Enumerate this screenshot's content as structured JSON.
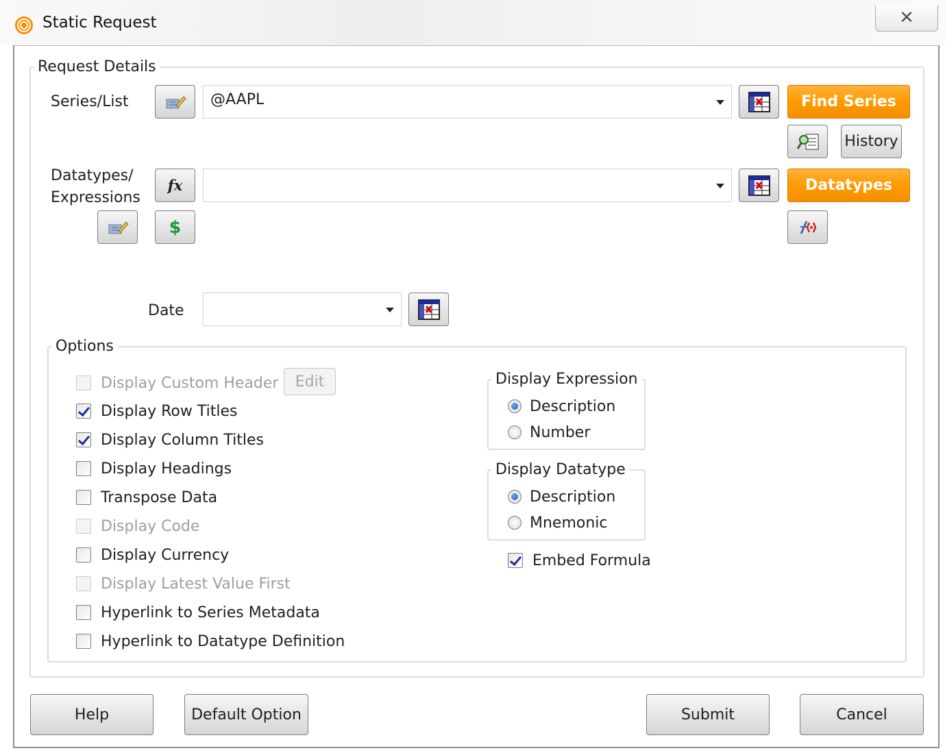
{
  "window": {
    "title": "Static Request",
    "close_glyph": "✕"
  },
  "request_details": {
    "legend": "Request Details",
    "series_label": "Series/List",
    "series_value": "@AAPL",
    "find_series_label": "Find Series",
    "history_label": "History",
    "datatypes_label_line1": "Datatypes/",
    "datatypes_label_line2": "Expressions",
    "datatypes_value": "",
    "datatypes_button_label": "Datatypes",
    "currency_glyph": "$",
    "fx_glyph": "fx",
    "date_label": "Date",
    "date_value": ""
  },
  "options": {
    "legend": "Options",
    "edit_label": "Edit",
    "checkboxes": [
      {
        "label": "Display Custom Header",
        "checked": false,
        "disabled": true
      },
      {
        "label": "Display Row Titles",
        "checked": true,
        "disabled": false
      },
      {
        "label": "Display Column Titles",
        "checked": true,
        "disabled": false
      },
      {
        "label": "Display Headings",
        "checked": false,
        "disabled": false
      },
      {
        "label": "Transpose Data",
        "checked": false,
        "disabled": false
      },
      {
        "label": "Display Code",
        "checked": false,
        "disabled": true
      },
      {
        "label": "Display Currency",
        "checked": false,
        "disabled": false
      },
      {
        "label": "Display Latest Value First",
        "checked": false,
        "disabled": true
      },
      {
        "label": "Hyperlink to Series Metadata",
        "checked": false,
        "disabled": false
      },
      {
        "label": "Hyperlink to Datatype Definition",
        "checked": false,
        "disabled": false
      }
    ],
    "display_expression": {
      "legend": "Display Expression",
      "options": [
        {
          "label": "Description",
          "selected": true
        },
        {
          "label": "Number",
          "selected": false
        }
      ]
    },
    "display_datatype": {
      "legend": "Display Datatype",
      "options": [
        {
          "label": "Description",
          "selected": true
        },
        {
          "label": "Mnemonic",
          "selected": false
        }
      ]
    },
    "embed_formula": {
      "label": "Embed Formula",
      "checked": true
    }
  },
  "footer": {
    "help_label": "Help",
    "default_option_label": "Default Option",
    "submit_label": "Submit",
    "cancel_label": "Cancel"
  },
  "colors": {
    "accent_orange": "#ff9a00",
    "check_blue": "#1d2a9c"
  }
}
